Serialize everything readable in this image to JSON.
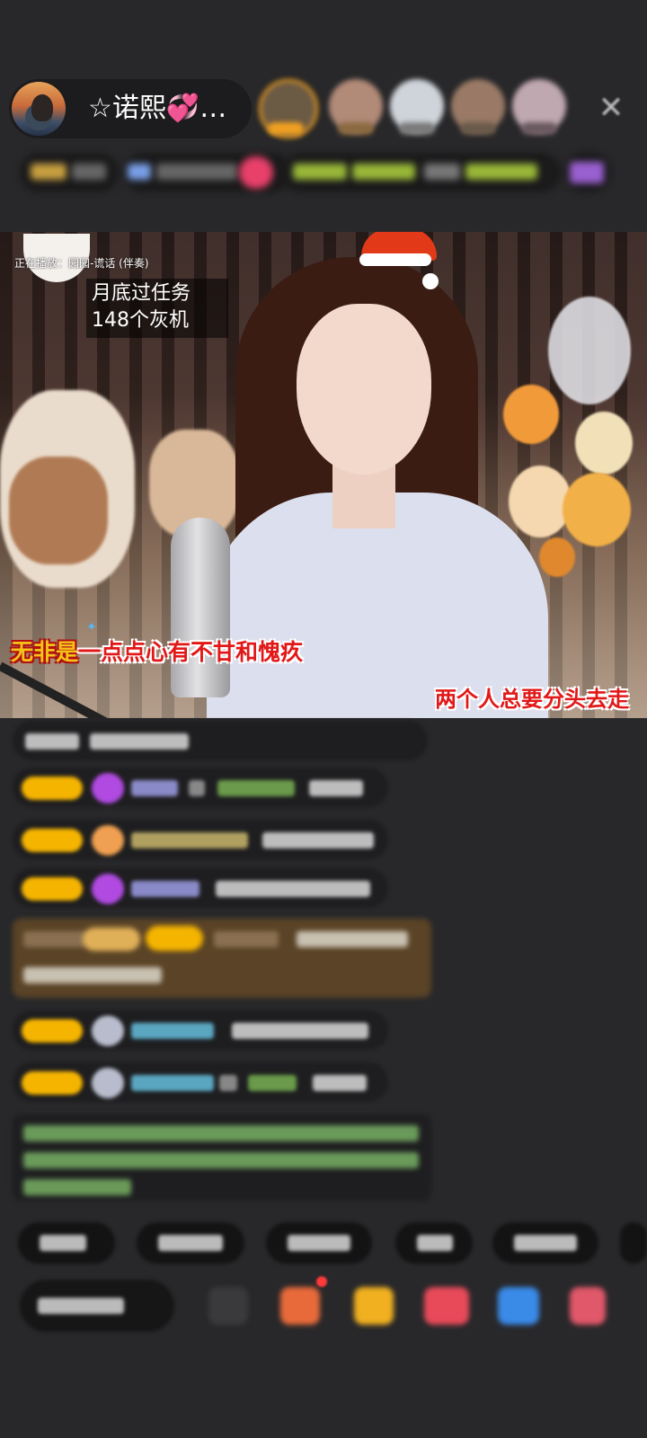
{
  "header": {
    "host_name": "☆诺熙💞…"
  },
  "video": {
    "now_playing": "正在播放：园园-谎话 (伴奏)",
    "task_lines": [
      "月底过任务",
      "148个灰机"
    ],
    "lyric_left_first": "无非是",
    "lyric_left_rest": "一点点心有不甘和愧疚",
    "lyric_right": "两个人总要分头去走"
  },
  "icons": {
    "close": "close-icon",
    "sparkle": "sparkle-icon"
  },
  "colors": {
    "background": "#28282a",
    "level_badge": "#f5b400",
    "lyric_red": "#e21818",
    "santa_red": "#e23a18"
  }
}
